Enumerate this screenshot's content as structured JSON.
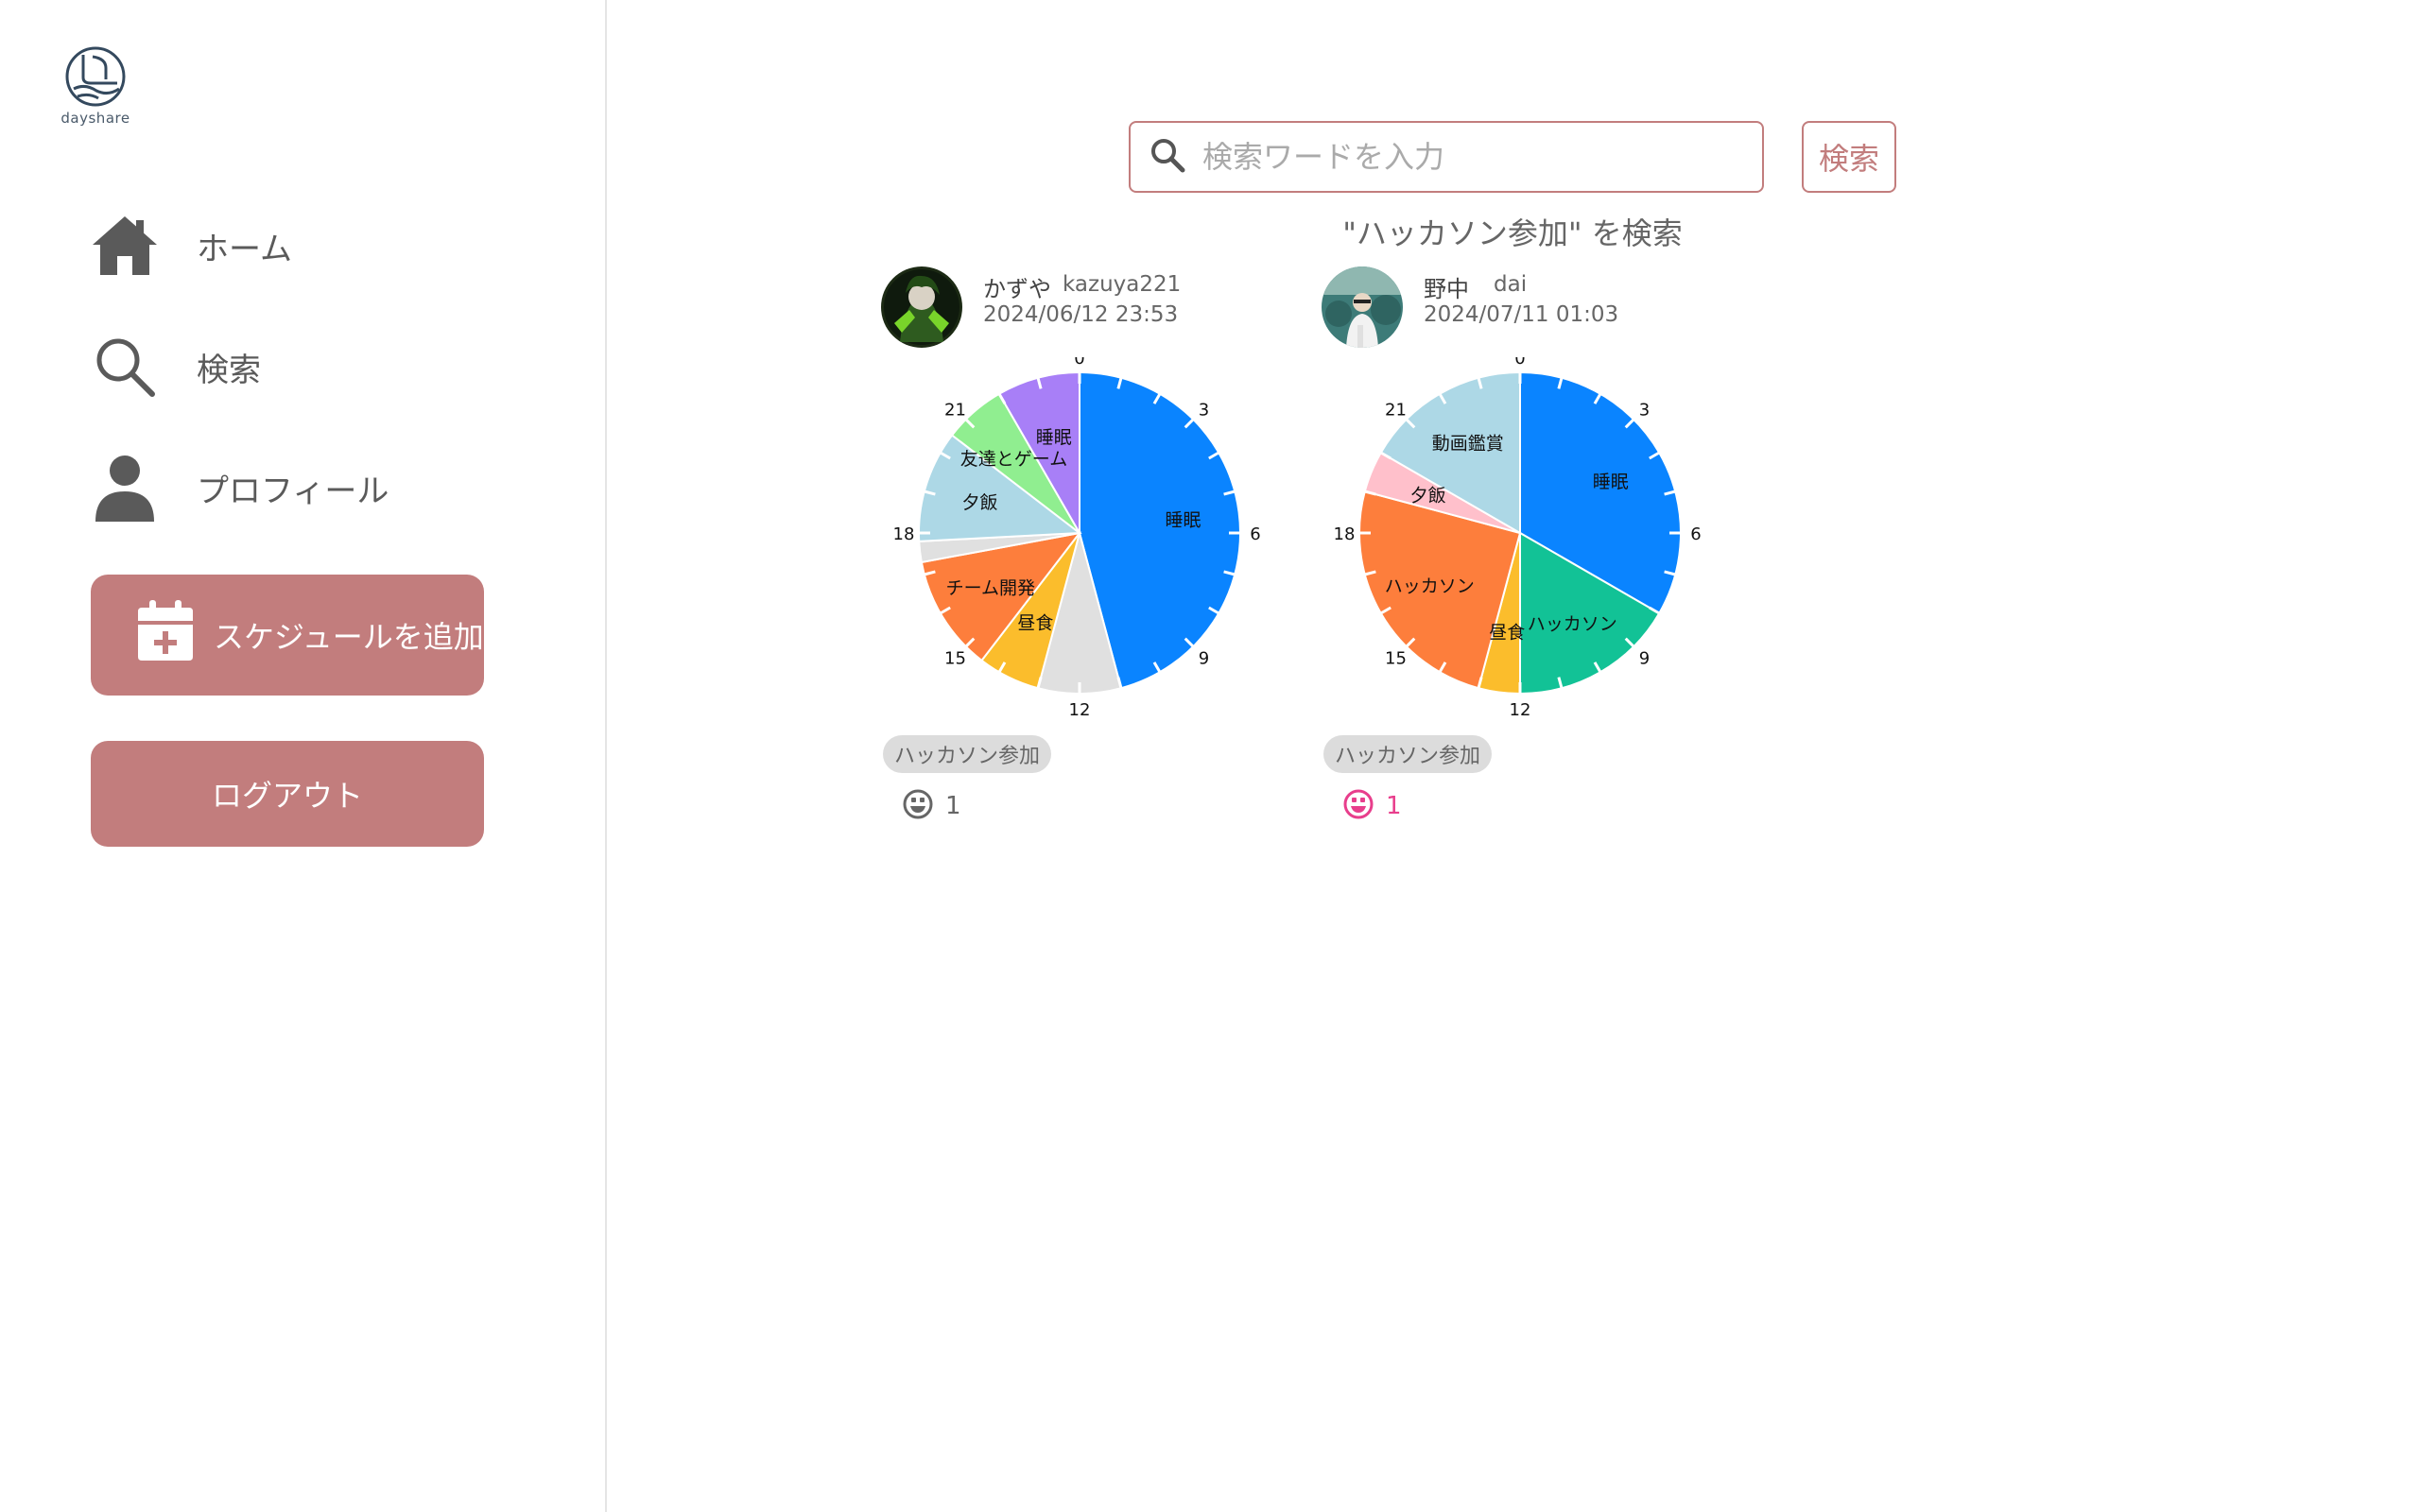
{
  "app": {
    "logo_text": "dayshare"
  },
  "sidebar": {
    "items": [
      {
        "label": "ホーム",
        "icon": "home-icon"
      },
      {
        "label": "検索",
        "icon": "search-icon"
      },
      {
        "label": "プロフィール",
        "icon": "user-icon"
      }
    ],
    "add_schedule_label": "スケジュールを追加",
    "logout_label": "ログアウト"
  },
  "search": {
    "placeholder": "検索ワードを入力",
    "button_label": "検索",
    "result_title": "\"ハッカソン参加\" を検索"
  },
  "colors": {
    "accent": "#c27d7d",
    "like_active": "#e83e8c"
  },
  "posts": [
    {
      "name": "かずや",
      "user_id": "kazuya221",
      "date": "2024/06/12 23:53",
      "tag": "ハッカソン参加",
      "likes": "1",
      "liked": false
    },
    {
      "name": "野中",
      "user_id": "dai",
      "date": "2024/07/11 01:03",
      "tag": "ハッカソン参加",
      "likes": "1",
      "liked": true
    }
  ],
  "chart_data": [
    {
      "type": "pie",
      "unit": "hours (24h clock)",
      "hour_labels": [
        "0",
        "3",
        "6",
        "9",
        "12",
        "15",
        "18",
        "21"
      ],
      "segments": [
        {
          "label": "睡眠",
          "start": 0,
          "end": 11,
          "color": "#0a84ff"
        },
        {
          "label": "",
          "start": 11,
          "end": 13,
          "color": "#e0e0e0"
        },
        {
          "label": "昼食",
          "start": 13,
          "end": 14.5,
          "color": "#fbbd2c"
        },
        {
          "label": "チーム開発",
          "start": 14.5,
          "end": 17.3,
          "color": "#fd7e3c"
        },
        {
          "label": "",
          "start": 17.3,
          "end": 17.8,
          "color": "#e0e0e0"
        },
        {
          "label": "夕飯",
          "start": 17.8,
          "end": 20.5,
          "color": "#add8e6"
        },
        {
          "label": "友達とゲーム",
          "start": 20.5,
          "end": 22,
          "color": "#90ee90"
        },
        {
          "label": "睡眠",
          "start": 22,
          "end": 24,
          "color": "#a87ff7"
        }
      ]
    },
    {
      "type": "pie",
      "unit": "hours (24h clock)",
      "hour_labels": [
        "0",
        "3",
        "6",
        "9",
        "12",
        "15",
        "18",
        "21"
      ],
      "segments": [
        {
          "label": "睡眠",
          "start": 0,
          "end": 8,
          "color": "#0a84ff"
        },
        {
          "label": "ハッカソン",
          "start": 8,
          "end": 12,
          "color": "#12c296"
        },
        {
          "label": "昼食",
          "start": 12,
          "end": 13,
          "color": "#fbbd2c"
        },
        {
          "label": "ハッカソン",
          "start": 13,
          "end": 19,
          "color": "#fd7e3c"
        },
        {
          "label": "夕飯",
          "start": 19,
          "end": 20,
          "color": "#ffc0cb"
        },
        {
          "label": "動画鑑賞",
          "start": 20,
          "end": 24,
          "color": "#add8e6"
        }
      ]
    }
  ]
}
